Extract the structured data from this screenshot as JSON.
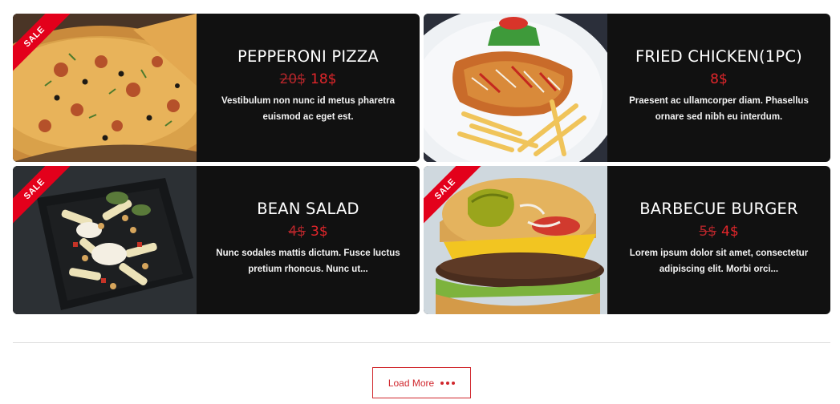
{
  "products": [
    {
      "name": "PEPPERONI PIZZA",
      "old_price": "20$",
      "price": "18$",
      "description": "Vestibulum non nunc id metus pharetra euismod ac eget est.",
      "sale_badge": "SALE",
      "image": "pizza-photo"
    },
    {
      "name": "FRIED CHICKEN(1PC)",
      "old_price": "",
      "price": "8$",
      "description": "Praesent ac ullamcorper diam. Phasellus ornare sed nibh eu interdum.",
      "sale_badge": "",
      "image": "fried-chicken-photo"
    },
    {
      "name": "BEAN SALAD",
      "old_price": "4$",
      "price": "3$",
      "description": "Nunc sodales mattis dictum. Fusce luctus pretium rhoncus. Nunc ut...",
      "sale_badge": "SALE",
      "image": "bean-salad-photo"
    },
    {
      "name": "BARBECUE BURGER",
      "old_price": "5$",
      "price": "4$",
      "description": "Lorem ipsum dolor sit amet, consectetur adipiscing elit. Morbi orci...",
      "sale_badge": "SALE",
      "image": "burger-photo"
    }
  ],
  "load_more": {
    "label": "Load More",
    "icon": "more-dots-icon"
  },
  "colors": {
    "accent": "#e2262b",
    "card_bg": "#111111",
    "ribbon": "#e3001b"
  }
}
